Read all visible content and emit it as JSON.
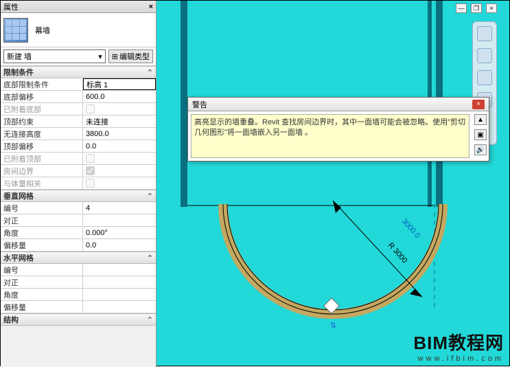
{
  "panel": {
    "title": "属性",
    "type_label": "幕墙",
    "selector": {
      "value": "新建 墙",
      "edit_btn": "编辑类型"
    },
    "groups": [
      {
        "name": "限制条件",
        "rows": [
          {
            "k": "底部限制条件",
            "v": "标高 1",
            "boxed": true
          },
          {
            "k": "底部偏移",
            "v": "600.0"
          },
          {
            "k": "已附着底部",
            "v": "",
            "check": false,
            "disabled": true
          },
          {
            "k": "顶部约束",
            "v": "未连接"
          },
          {
            "k": "无连接高度",
            "v": "3800.0"
          },
          {
            "k": "顶部偏移",
            "v": "0.0"
          },
          {
            "k": "已附着顶部",
            "v": "",
            "check": false,
            "disabled": true
          },
          {
            "k": "房间边界",
            "v": "",
            "check": true,
            "disabled": true
          },
          {
            "k": "与体量相关",
            "v": "",
            "check": false,
            "disabled": true
          }
        ]
      },
      {
        "name": "垂直网格",
        "rows": [
          {
            "k": "编号",
            "v": "4"
          },
          {
            "k": "对正",
            "v": ""
          },
          {
            "k": "角度",
            "v": "0.000°"
          },
          {
            "k": "偏移量",
            "v": "0.0"
          }
        ]
      },
      {
        "name": "水平网格",
        "rows": [
          {
            "k": "编号",
            "v": ""
          },
          {
            "k": "对正",
            "v": ""
          },
          {
            "k": "角度",
            "v": ""
          },
          {
            "k": "偏移量",
            "v": ""
          }
        ]
      },
      {
        "name": "结构",
        "rows": []
      }
    ]
  },
  "warning": {
    "title": "警告",
    "text": "高亮显示的墙重叠。Revit 查找房间边界时，其中一面墙可能会被忽略。使用\"剪切几何图形\"将一面墙嵌入另一面墙 。"
  },
  "drawing": {
    "radius_label": "R 3000",
    "dim_label": "3000.0"
  },
  "watermark": {
    "big": "BIM教程网",
    "small": "www.ifbim.com"
  }
}
